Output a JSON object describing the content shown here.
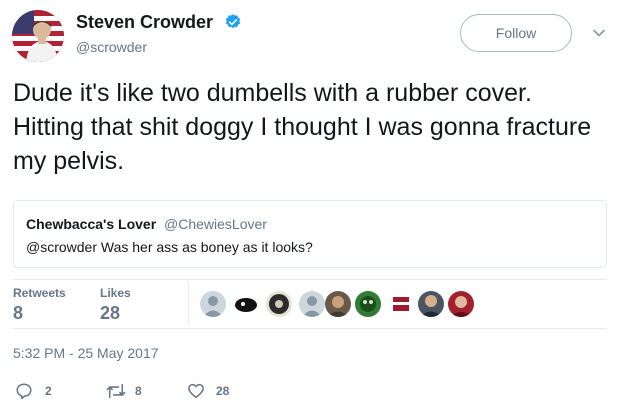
{
  "author": {
    "name": "Steven Crowder",
    "handle": "@scrowder"
  },
  "follow_label": "Follow",
  "tweet_text": "Dude it's like two dumbells with a rubber cover. Hitting that shit doggy I thought I was gonna fracture my pelvis.",
  "quoted": {
    "name": "Chewbacca's Lover",
    "handle": "@ChewiesLover",
    "text": "@scrowder Was her ass as boney as it looks?"
  },
  "stats": {
    "retweets_label": "Retweets",
    "retweets_value": "8",
    "likes_label": "Likes",
    "likes_value": "28"
  },
  "timestamp": "5:32 PM - 25 May 2017",
  "actions": {
    "reply_count": "2",
    "retweet_count": "8",
    "like_count": "28"
  },
  "colors": {
    "verified_blue": "#1da1f2",
    "secondary_text": "#657786",
    "border": "#e1e8ed"
  },
  "icons": [
    "verified-badge-icon",
    "chevron-down-icon",
    "reply-icon",
    "retweet-icon",
    "like-icon"
  ]
}
